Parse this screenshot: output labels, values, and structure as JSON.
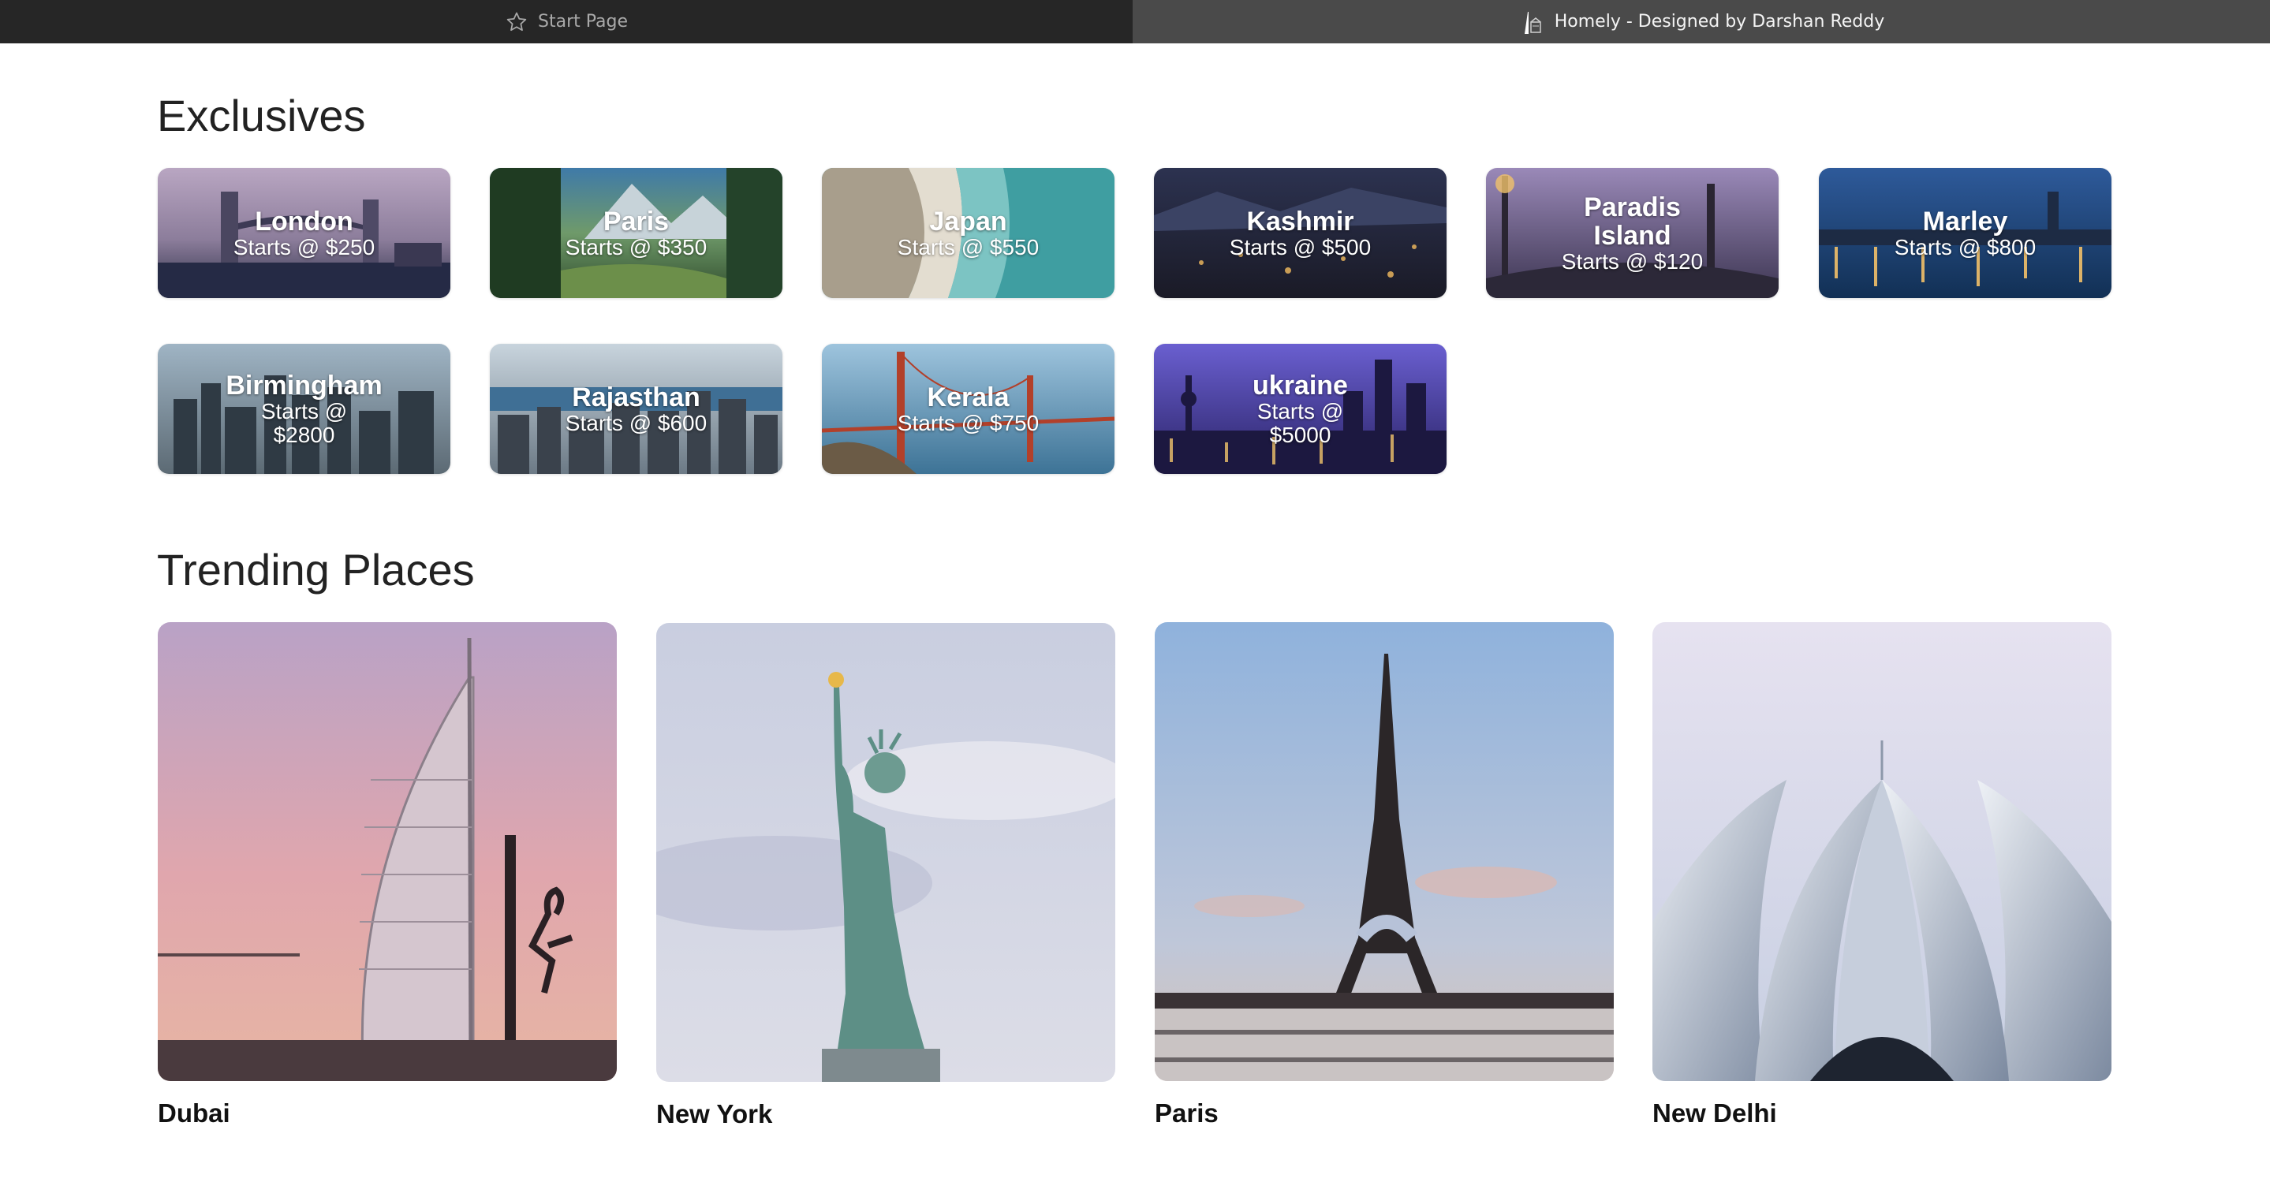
{
  "tabs": [
    {
      "label": "Start Page",
      "active": false,
      "icon": "star-icon"
    },
    {
      "label": "Homely - Designed by Darshan Reddy",
      "active": true,
      "icon": "site-favicon-icon"
    }
  ],
  "exclusives": {
    "title": "Exclusives",
    "cards": [
      {
        "name": "London",
        "price": "Starts @ $250"
      },
      {
        "name": "Paris",
        "price": "Starts @ $350"
      },
      {
        "name": "Japan",
        "price": "Starts @ $550"
      },
      {
        "name": "Kashmir",
        "price": "Starts @ $500"
      },
      {
        "name": "Paradis Island",
        "price": "Starts @ $120"
      },
      {
        "name": "Marley",
        "price": "Starts @ $800"
      },
      {
        "name": "Birmingham",
        "price": "Starts @ $2800"
      },
      {
        "name": "Rajasthan",
        "price": "Starts @ $600"
      },
      {
        "name": "Kerala",
        "price": "Starts @ $750"
      },
      {
        "name": "ukraine",
        "price": "Starts @ $5000"
      }
    ]
  },
  "trending": {
    "title": "Trending Places",
    "places": [
      {
        "name": "Dubai"
      },
      {
        "name": "New York"
      },
      {
        "name": "Paris"
      },
      {
        "name": "New Delhi"
      }
    ]
  }
}
